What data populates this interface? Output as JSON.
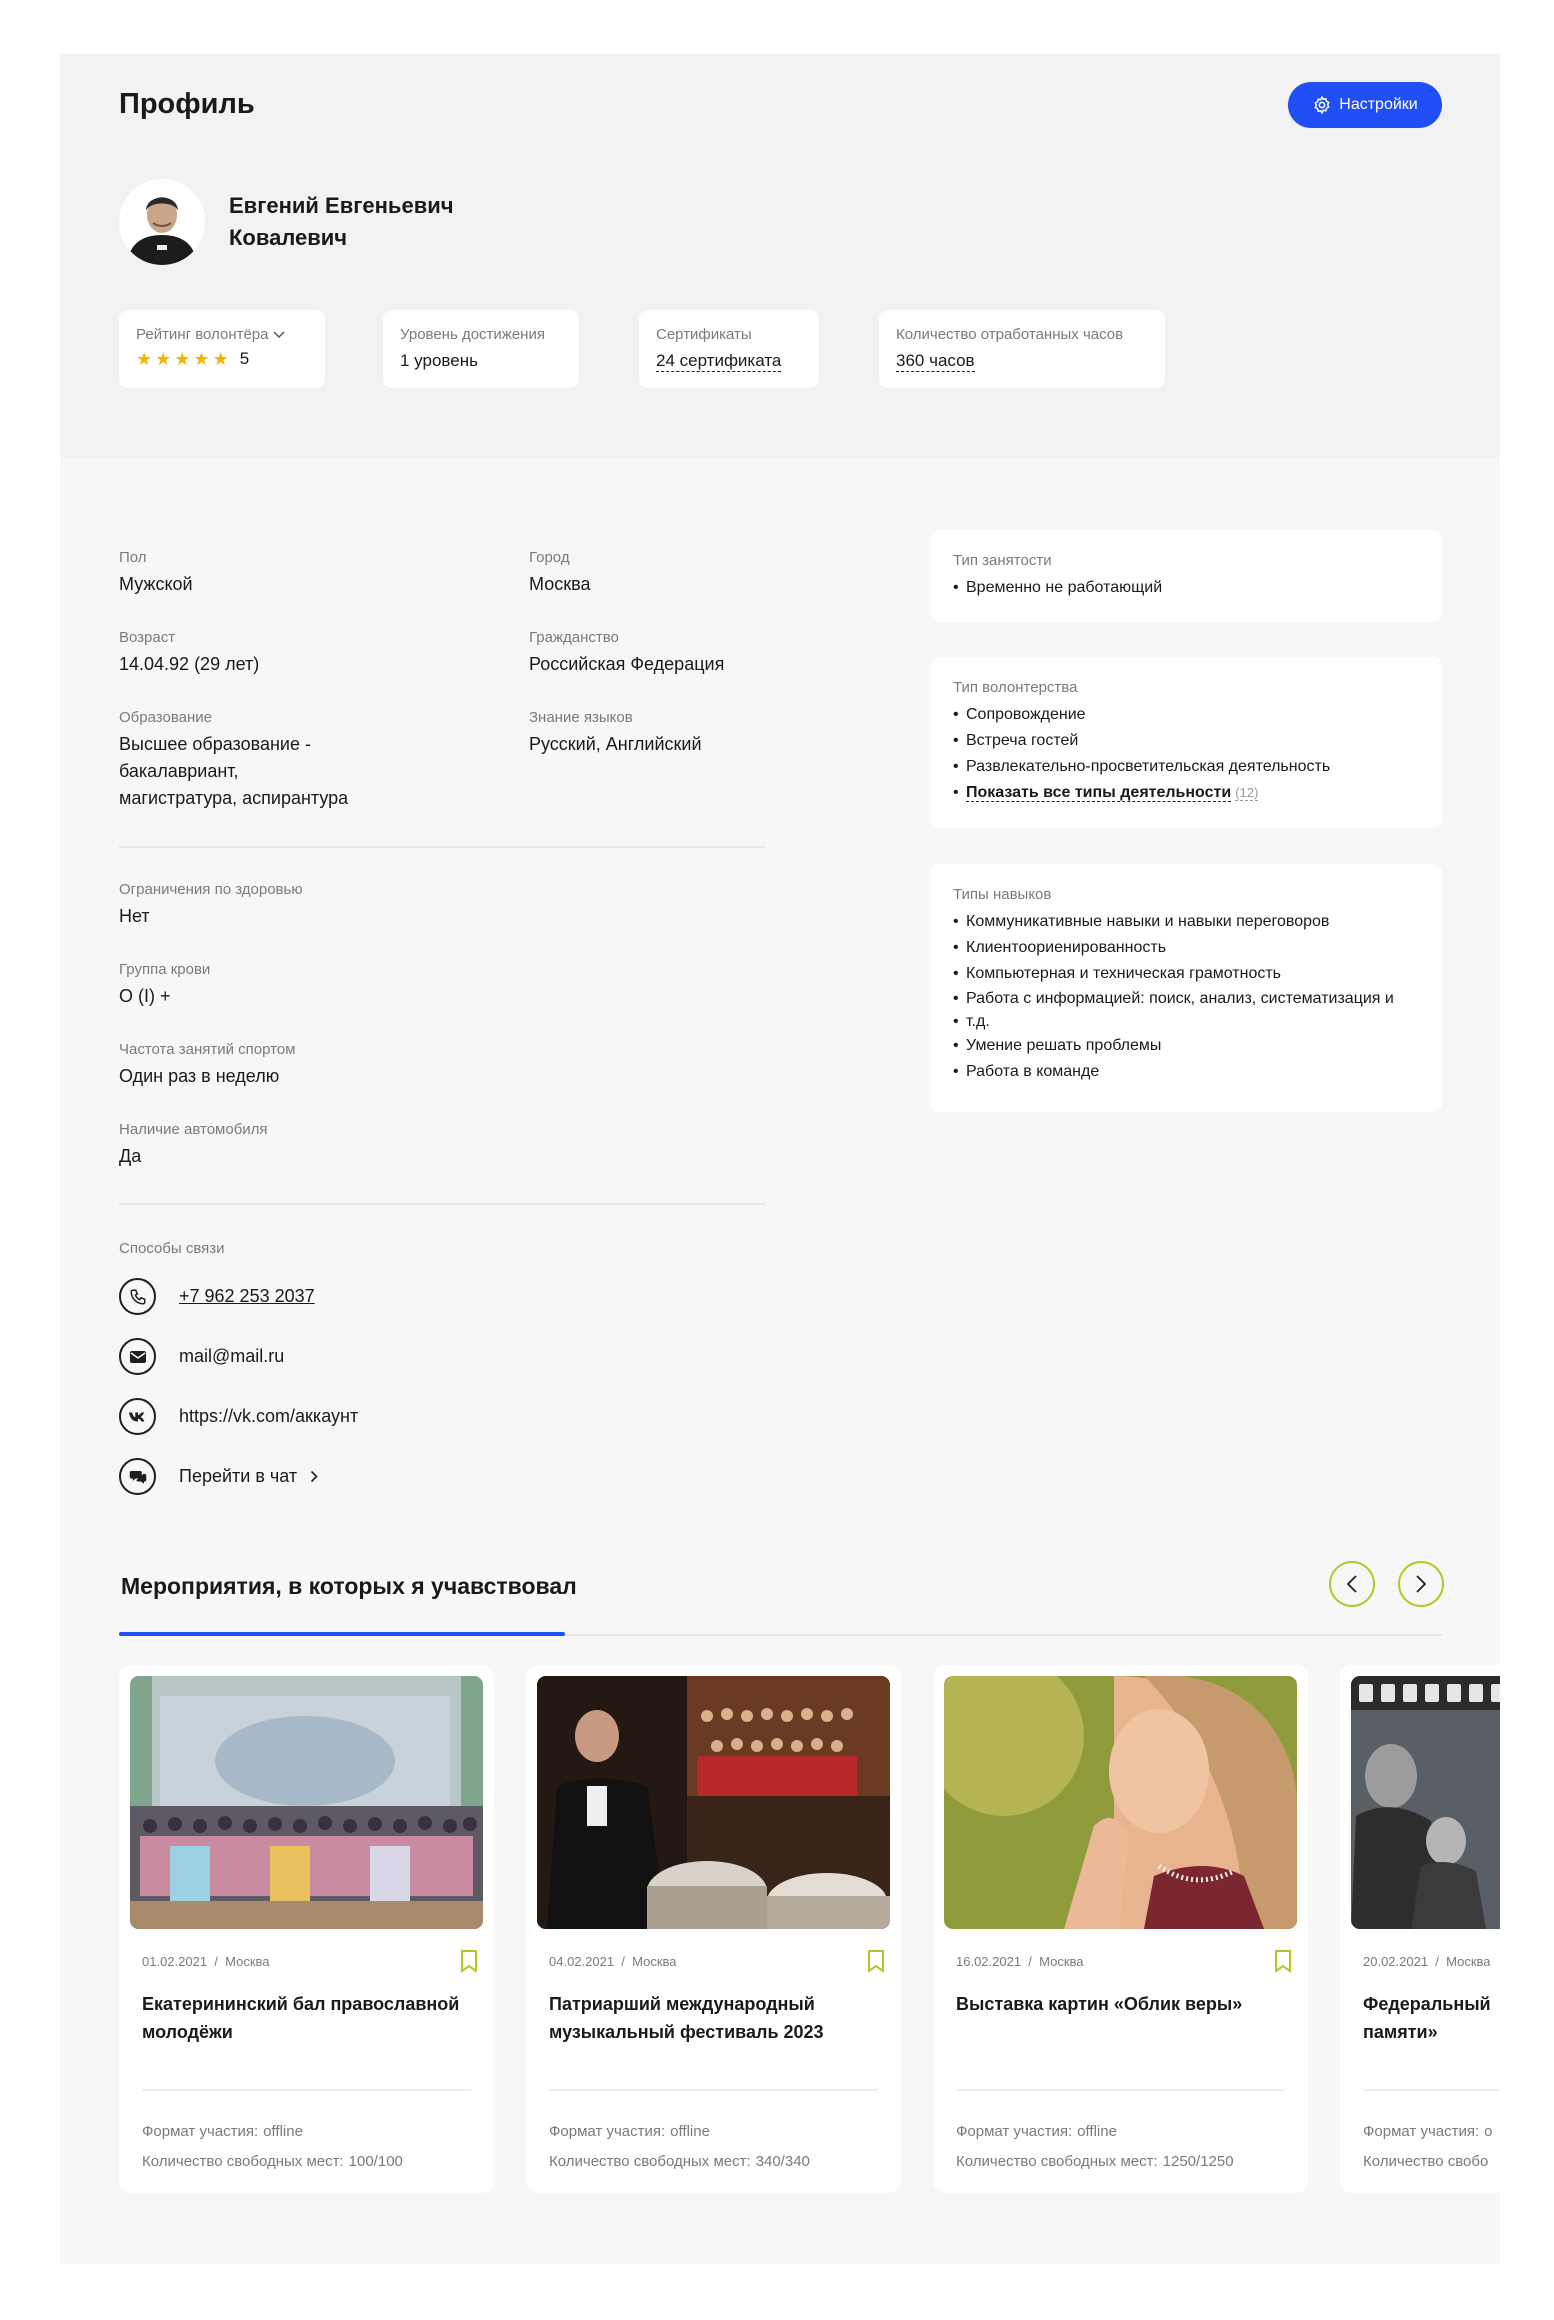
{
  "header": {
    "title": "Профиль",
    "settings_label": "Настройки"
  },
  "user": {
    "name": "Евгений Евгеньевич Ковалевич"
  },
  "stats": {
    "rating": {
      "label": "Рейтинг волонтёра",
      "stars": 5,
      "value": "5"
    },
    "level": {
      "label": "Уровень достижения",
      "value": "1 уровень"
    },
    "certificates": {
      "label": "Сертификаты",
      "value": "24 сертификата"
    },
    "hours": {
      "label": "Количество отработанных часов",
      "value": "360 часов"
    }
  },
  "personal": {
    "gender": {
      "label": "Пол",
      "value": "Мужской"
    },
    "city": {
      "label": "Город",
      "value": "Москва"
    },
    "age": {
      "label": "Возраст",
      "value": "14.04.92 (29 лет)"
    },
    "citizenship": {
      "label": "Гражданство",
      "value": "Российская Федерация"
    },
    "education": {
      "label": "Образование",
      "value_1": "Высшее образование -",
      "value_2": "бакалавриант,",
      "value_3": "магистратура, аспирантура"
    },
    "languages": {
      "label": "Знание языков",
      "value": "Русский, Английский"
    }
  },
  "health": {
    "restrictions": {
      "label": "Ограничения по здоровью",
      "value": "Нет"
    },
    "blood": {
      "label": "Группа крови",
      "value": "O (I) +"
    },
    "sport": {
      "label": "Частота занятий спортом",
      "value": "Один раз в неделю"
    },
    "car": {
      "label": "Наличие автомобиля",
      "value": "Да"
    }
  },
  "contacts": {
    "title": "Способы связи",
    "phone": "+7 962 253 2037",
    "email": "mail@mail.ru",
    "vk": "https://vk.com/аккаунт",
    "chat": "Перейти в чат"
  },
  "employment": {
    "label": "Тип занятости",
    "items": [
      "Временно не работающий"
    ]
  },
  "volunteering": {
    "label": "Тип волонтерства",
    "items": [
      "Сопровождение",
      "Встреча гостей",
      "Развлекательно-просветительская деятельность"
    ],
    "show_all": "Показать все типы деятельности",
    "show_all_count": "(12)"
  },
  "skills": {
    "label": "Типы навыков",
    "items": [
      "Коммуникативные навыки и навыки переговоров",
      "Клиентоориенированность",
      "Компьютерная и техническая грамотность",
      "Работа с информацией: поиск, анализ, систематизация и",
      "т.д.",
      "Умение решать проблемы",
      "Работа в команде"
    ]
  },
  "events": {
    "title": "Мероприятия, в которых я учавствовал",
    "format_label": "Формат участия:",
    "seats_label": "Количество свободных мест:",
    "cards": [
      {
        "date": "01.02.2021",
        "city": "Москва",
        "title": "Екатерининский бал православной молодёжи",
        "format": "offline",
        "seats": "100/100"
      },
      {
        "date": "04.02.2021",
        "city": "Москва",
        "title": "Патриарший международный музыкальный фестиваль 2023",
        "format": "offline",
        "seats": "340/340"
      },
      {
        "date": "16.02.2021",
        "city": "Москва",
        "title": "Выставка картин «Облик веры»",
        "format": "offline",
        "seats": "1250/1250"
      },
      {
        "date": "20.02.2021",
        "city": "Москва",
        "title": "Федеральный",
        "title_2": "памяти»",
        "format": "o",
        "seats": "Количество свобо"
      }
    ]
  },
  "colors": {
    "accent": "#1f4ff5",
    "star": "#f5b400",
    "bookmark": "#b0c927",
    "hero_bg": "#f2f2f2",
    "page_bg": "#f7f7f7"
  }
}
